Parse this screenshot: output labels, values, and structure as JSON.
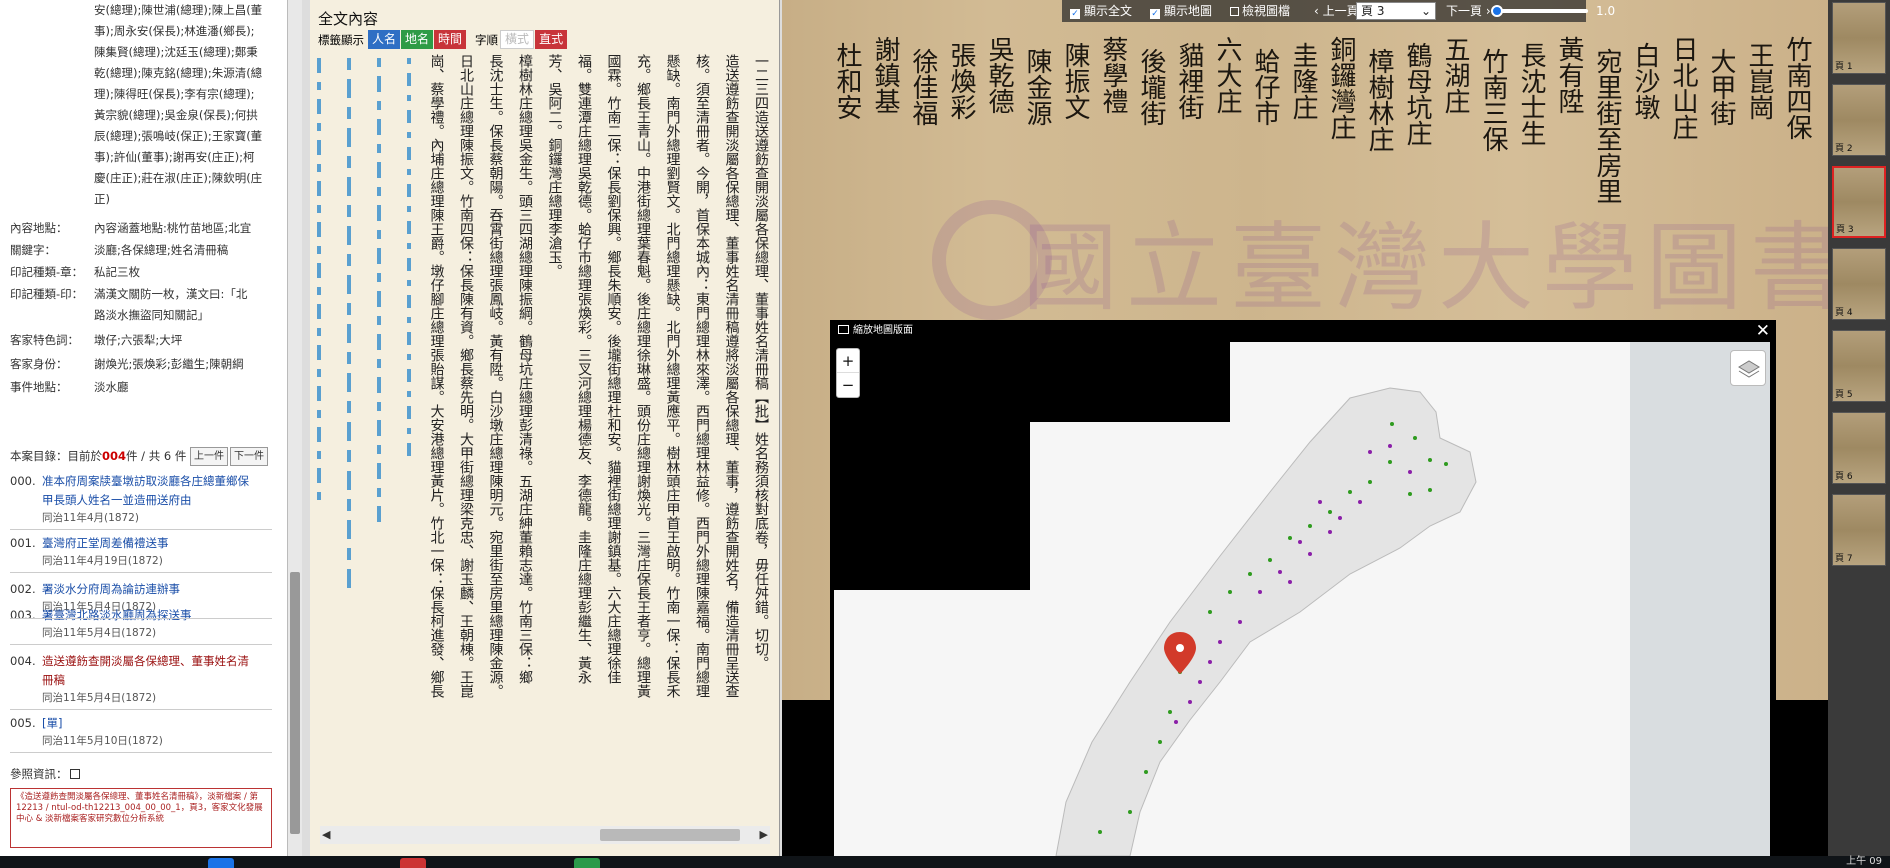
{
  "meta_top_lines": [
    "安(總理);陳世浦(總理);陳上昌(董",
    "事);周永安(保長);林進潘(鄉長);",
    "陳集賢(總理);沈廷玉(總理);鄭秉",
    "乾(總理);陳克銘(總理);朱源清(總",
    "理);陳得旺(保長);李有宗(總理);",
    "黃宗貌(總理);吳金泉(保長);何拱",
    "辰(總理);張鳴岐(保正);王家寶(董",
    "事);許仙(董事);謝再安(庄正);柯",
    "慶(庄正);莊在淑(庄正);陳欽明(庄",
    "正)"
  ],
  "meta_rows": [
    {
      "k": "內容地點：",
      "v": "內容涵蓋地點:桃竹苗地區;北宜"
    },
    {
      "k": "關鍵字：",
      "v": "淡廳;各保總理;姓名清冊稿"
    },
    {
      "k": "印記種類-章：",
      "v": "私記三枚"
    },
    {
      "k": "印記種類-印：",
      "v": "滿漢文關防一枚，漢文曰:「北"
    },
    {
      "k": "",
      "v": "路淡水撫盜同知關記」"
    },
    {
      "k": "客家特色詞：",
      "v": "墩仔;六張犁;大坪"
    },
    {
      "k": "客家身份：",
      "v": "謝煥光;張煥彩;彭繼生;陳朝綱"
    },
    {
      "k": "事件地點：",
      "v": "淡水廳"
    }
  ],
  "case_bar": {
    "prefix": "本案目錄：目前於",
    "current": "004",
    "suffix": "件 / 共 6 件",
    "prev": "上一件",
    "next": "下一件"
  },
  "cases": [
    {
      "idx": "000.",
      "lines": [
        "准本府周案牍臺墩訪取淡廳各庄總董鄉保",
        "甲長頭人姓名一並造冊送府由"
      ],
      "date": "同治11年4月(1872)",
      "current": false
    },
    {
      "idx": "001.",
      "lines": [
        "臺灣府正堂周差備禮送事"
      ],
      "date": "同治11年4月19日(1872)",
      "current": false
    },
    {
      "idx": "002.",
      "lines": [
        "署淡水分府周為論訪連辦事"
      ],
      "date": "同治11年5月4日(1872)",
      "current": false
    },
    {
      "idx": "003.",
      "lines": [
        "署臺灣北路淡水廳周為探送事"
      ],
      "date": "同治11年5月4日(1872)",
      "current": false
    },
    {
      "idx": "004.",
      "lines": [
        "造送遵飭查開淡屬各保總理、董事姓名清",
        "冊稿"
      ],
      "date": "同治11年5月4日(1872)",
      "current": true
    },
    {
      "idx": "005.",
      "lines": [
        "[單]"
      ],
      "date": "同治11年5月10日(1872)",
      "current": false
    }
  ],
  "ref_title": "參照資訊：",
  "ref_text": "《造送遵飭查開淡屬各保總理、董事姓名清冊稿》，淡新檔案 / 第12213 / ntul-od-th12213_004_00_00_1，頁3，客家文化發展中心 & 淡新檔案客家研究數位分析系統",
  "fulltext": {
    "title": "全文內容",
    "tag_label": "標籤顯示",
    "tags": [
      {
        "label": "人名",
        "color": "#2f6fc4"
      },
      {
        "label": "地名",
        "color": "#2e9b46"
      },
      {
        "label": "時間",
        "color": "#c8343a"
      }
    ],
    "order_label": "字順",
    "order_opts": [
      "橫式",
      "直式"
    ],
    "columns": [
      "一二三四造送遵飭查開淡屬各保總理、董事姓名清冊稿【批】姓名務須核對底卷，毋任舛錯。切切。",
      "造送遵飭查開淡屬各保總理、董事姓名清冊稿遵將淡屬各保總理、董事，遵飭查開姓名，備造清冊呈送查",
      "核。須至清冊者。今開，首保本城內：東門總理林來澤。西門總理林益修。西門外總理陳嘉福。南門總理",
      "懸缺。南門外總理劉賢文。北門總理懸缺。北門外總理黃應平。樹林頭庄甲首王啟明。竹南一保：保長禾",
      "充。鄉長王青山。中港街總理葉春魁。後庄總理徐琳盛。頭份庄總理謝煥光。三灣庄保長王者亨。總理黃",
      "國霖。竹南二保：保長劉保興。鄉長朱順安。後壠街總理杜和安。貓裡街總理謝鎮基。六大庄總理徐佳",
      "福。雙連潭庄總理吳乾德。蛤仔市總理張煥彩。三叉河總理楊德友、李德龍。圭隆庄總理彭繼生、黃永",
      "芳、吳阿二。銅鑼灣庄總理李滄玉。",
      "樟樹林庄總理吳金生。頭三四湖總理陳振綱。鶴母坑庄總理彭清祿。五湖庄紳董賴志達。竹南三保：鄉",
      "長沈士生。保長蔡朝陽。吞霄街總理張鳳岐。黃有陞。白沙墩庄總理陳明元。宛里街至房里總理陳金源。",
      "日北山庄總理陳振文。竹南四保：保長陳有資。鄉長蔡先明。大甲街總理梁克忠、謝玉麟、王朝棟。王崑",
      "崗、蔡學禮。內埔庄總理陳王爵。墩仔腳庄總理張貽謀。大安港總理黃片。竹北一保：保長柯進發、鄉長"
    ],
    "ghost_cols": 6
  },
  "viewer": {
    "show_fulltext": "顯示全文",
    "show_map": "顯示地圖",
    "view_image": "檢視圖檔",
    "prev_page": "上一頁",
    "page_value": "頁 3",
    "next_page": "下一頁",
    "zoom": "1.0",
    "zoom_level": 1.0,
    "doc_cols": [
      "竹南四保",
      "王崑崗",
      "大甲街",
      "日北山庄",
      "白沙墩",
      "宛里街至房里",
      "黃有陞",
      "長沈士生",
      "竹南三保",
      "五湖庄",
      "鶴母坑庄",
      "樟樹林庄",
      "銅鑼灣庄",
      "圭隆庄",
      "蛤仔市",
      "六大庄",
      "貓裡街",
      "後壠街",
      "蔡學禮",
      "陳振文",
      "陳金源",
      "吳乾德",
      "張煥彩",
      "徐佳福",
      "謝鎮基",
      "杜和安"
    ],
    "watermark": "國立臺灣大學圖書館"
  },
  "map": {
    "title": "縮放地圖版面",
    "close": "✕",
    "zoom_in": "+",
    "zoom_out": "−",
    "green_color": "#2e9b1e",
    "purple_color": "#8a1fa8",
    "marker_color": "#d23a2a"
  },
  "thumbs": [
    {
      "label": "頁 1"
    },
    {
      "label": "頁 2"
    },
    {
      "label": "頁 3",
      "selected": true
    },
    {
      "label": "頁 4"
    },
    {
      "label": "頁 5"
    },
    {
      "label": "頁 6"
    },
    {
      "label": "頁 7"
    }
  ],
  "clock": "上午 09"
}
